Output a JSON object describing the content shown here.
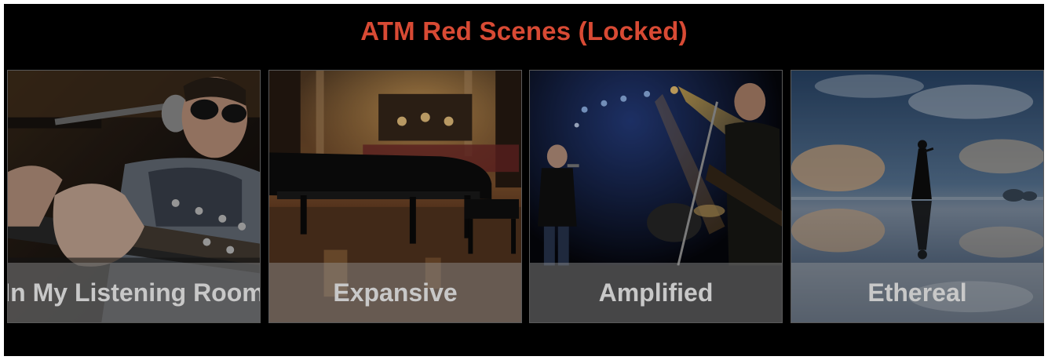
{
  "header": {
    "title": "ATM Red Scenes (Locked)",
    "title_color": "#d84a34"
  },
  "scenes": [
    {
      "label": "In My Listening Room",
      "image": "guitarist-with-sunglasses-photo"
    },
    {
      "label": "Expansive",
      "image": "grand-piano-concert-hall-photo"
    },
    {
      "label": "Amplified",
      "image": "rock-band-on-stage-photo"
    },
    {
      "label": "Ethereal",
      "image": "woman-on-reflective-salt-flat-photo"
    }
  ]
}
